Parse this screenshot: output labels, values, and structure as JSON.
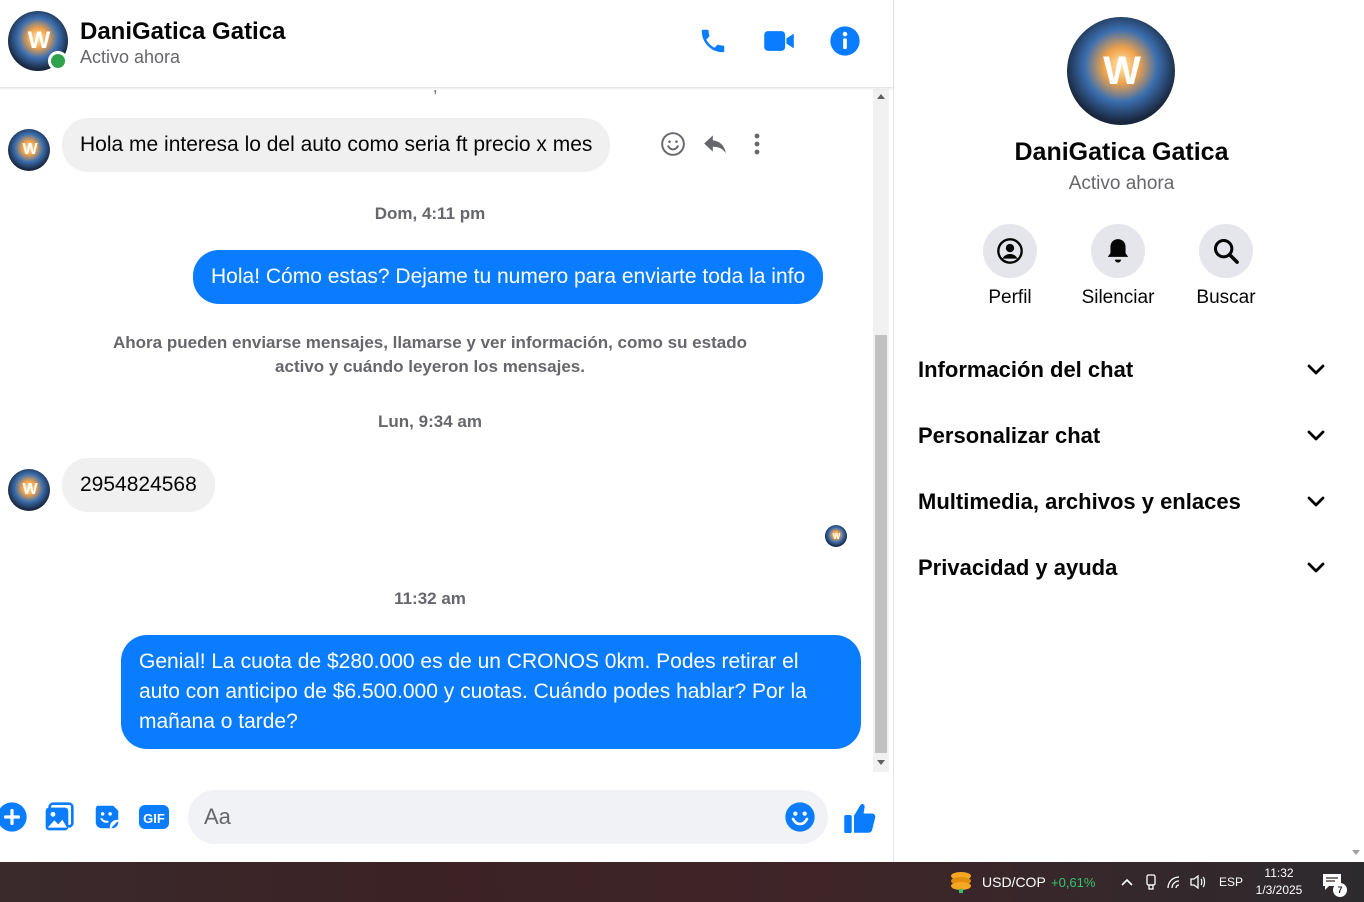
{
  "colors": {
    "accent": "#0a7cff",
    "online": "#31a24c",
    "incoming_bubble": "#f0f0f0",
    "taskbar_positive": "#35c36b"
  },
  "header": {
    "name": "DaniGatica Gatica",
    "status": "Activo ahora",
    "icons": [
      "phone-icon",
      "video-camera-icon",
      "info-icon"
    ]
  },
  "avatar_logo": "W",
  "messages": {
    "partial_top": "· ,",
    "m1": "Hola me interesa lo del auto como seria ft precio x mes",
    "ts1": "Dom, 4:11 pm",
    "m2": "Hola! Cómo estas? Dejame tu numero para enviarte toda la info",
    "system_note": "Ahora pueden enviarse mensajes, llamarse y ver información, como su estado activo y cuándo leyeron los mensajes.",
    "ts2": "Lun, 9:34 am",
    "m3": "2954824568",
    "ts3": "11:32 am",
    "m4": "Genial! La cuota de $280.000 es de un CRONOS 0km. Podes retirar el auto con anticipo de $6.500.000 y cuotas. Cuándo podes hablar? Por la mañana o tarde?"
  },
  "composer": {
    "placeholder": "Aa",
    "icons": [
      "plus-circle-icon",
      "image-icon",
      "sticker-icon",
      "gif-icon",
      "emoji-icon",
      "thumbs-up-icon"
    ],
    "gif_label": "GIF"
  },
  "panel": {
    "name": "DaniGatica Gatica",
    "status": "Activo ahora",
    "actions": [
      {
        "label": "Perfil",
        "icon": "profile-icon"
      },
      {
        "label": "Silenciar",
        "icon": "bell-icon"
      },
      {
        "label": "Buscar",
        "icon": "search-icon"
      }
    ],
    "sections": [
      "Información del chat",
      "Personalizar chat",
      "Multimedia, archivos y enlaces",
      "Privacidad y ayuda"
    ]
  },
  "taskbar": {
    "pair": "USD/COP",
    "change": "+0,61%",
    "lang": "ESP",
    "time": "11:32",
    "date": "1/3/2025",
    "notifications": "7"
  }
}
